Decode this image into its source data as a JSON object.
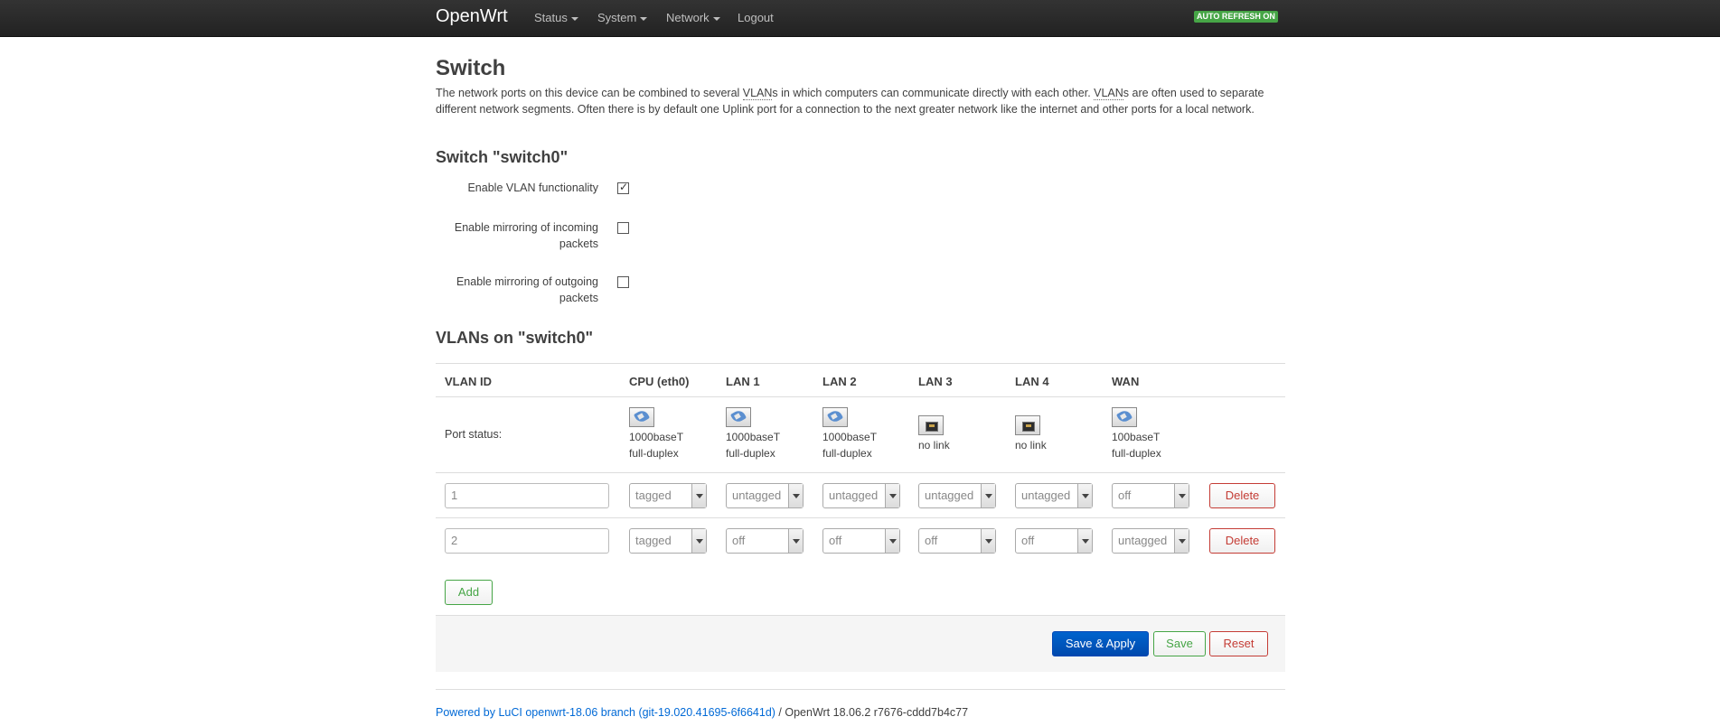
{
  "navbar": {
    "brand": "OpenWrt",
    "menu": [
      {
        "label": "Status",
        "dropdown": true
      },
      {
        "label": "System",
        "dropdown": true
      },
      {
        "label": "Network",
        "dropdown": true
      },
      {
        "label": "Logout",
        "dropdown": false
      }
    ],
    "auto_refresh": "AUTO REFRESH ON"
  },
  "page": {
    "title": "Switch",
    "description_parts": [
      "The network ports on this device can be combined to several ",
      "VLAN",
      "s in which computers can communicate directly with each other. ",
      "VLAN",
      "s are often used to separate different network segments. Often there is by default one Uplink port for a connection to the next greater network like the internet and other ports for a local network."
    ]
  },
  "switch_section": {
    "title": "Switch \"switch0\"",
    "options": [
      {
        "label": "Enable VLAN functionality",
        "checked": true
      },
      {
        "label": "Enable mirroring of incoming packets",
        "checked": false
      },
      {
        "label": "Enable mirroring of outgoing packets",
        "checked": false
      }
    ]
  },
  "vlan_section": {
    "title": "VLANs on \"switch0\"",
    "headers": [
      "VLAN ID",
      "CPU (eth0)",
      "LAN 1",
      "LAN 2",
      "LAN 3",
      "LAN 4",
      "WAN"
    ],
    "port_status_label": "Port status:",
    "ports": [
      {
        "icon": "port-connected-icon",
        "line1": "1000baseT",
        "line2": "full-duplex"
      },
      {
        "icon": "port-connected-icon",
        "line1": "1000baseT",
        "line2": "full-duplex"
      },
      {
        "icon": "port-connected-icon",
        "line1": "1000baseT",
        "line2": "full-duplex"
      },
      {
        "icon": "port-nolink-icon",
        "line1": "no link",
        "line2": ""
      },
      {
        "icon": "port-nolink-icon",
        "line1": "no link",
        "line2": ""
      },
      {
        "icon": "port-connected-icon",
        "line1": "100baseT",
        "line2": "full-duplex"
      }
    ],
    "rows": [
      {
        "vlan_id": "1",
        "values": [
          "tagged",
          "untagged",
          "untagged",
          "untagged",
          "untagged",
          "off"
        ]
      },
      {
        "vlan_id": "2",
        "values": [
          "tagged",
          "off",
          "off",
          "off",
          "off",
          "untagged"
        ]
      }
    ],
    "delete_label": "Delete",
    "add_label": "Add"
  },
  "actions": {
    "save_apply": "Save & Apply",
    "save": "Save",
    "reset": "Reset"
  },
  "footer": {
    "link_text": "Powered by LuCI openwrt-18.06 branch (git-19.020.41695-6f6641d)",
    "version_text": " / OpenWrt 18.06.2 r7676-cddd7b4c77"
  }
}
